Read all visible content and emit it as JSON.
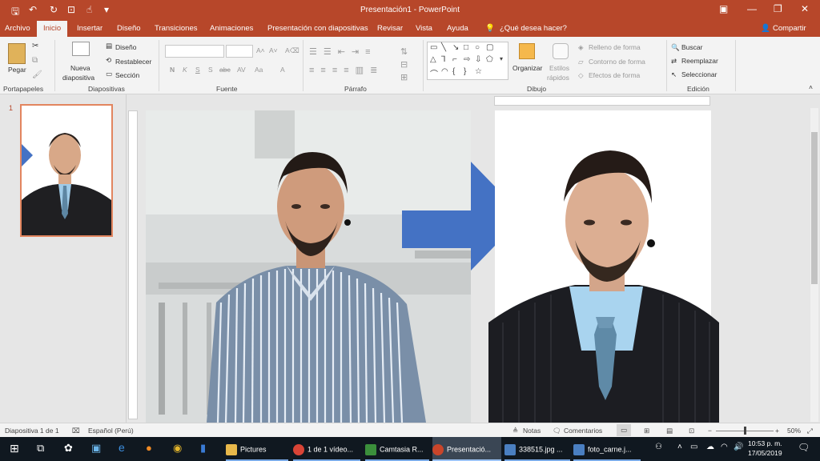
{
  "window": {
    "title": "Presentación1  -  PowerPoint",
    "share": "Compartir"
  },
  "quick_access": {
    "icons": [
      "save-icon",
      "undo-icon",
      "redo-icon",
      "present-icon",
      "touch-icon",
      "customize-icon"
    ]
  },
  "tabs": [
    "Archivo",
    "Inicio",
    "Insertar",
    "Diseño",
    "Transiciones",
    "Animaciones",
    "Presentación con diapositivas",
    "Revisar",
    "Vista",
    "Ayuda"
  ],
  "tell_me": "¿Qué desea hacer?",
  "ribbon": {
    "portapapeles": {
      "paste": "Pegar",
      "label": "Portapapeles"
    },
    "diapositivas": {
      "new_line1": "Nueva",
      "new_line2": "diapositiva",
      "layout": "Diseño",
      "reset": "Restablecer",
      "section": "Sección",
      "label": "Diapositivas"
    },
    "fuente": {
      "label": "Fuente",
      "buttons": [
        "N",
        "K",
        "S",
        "S",
        "abc",
        "AV",
        "Aa",
        "A"
      ]
    },
    "parrafo": {
      "label": "Párrafo"
    },
    "dibujo": {
      "organize": "Organizar",
      "styles_line1": "Estilos",
      "styles_line2": "rápidos",
      "fill": "Relleno de forma",
      "outline": "Contorno de forma",
      "effects": "Efectos de forma",
      "label": "Dibujo"
    },
    "edicion": {
      "find": "Buscar",
      "replace": "Reemplazar",
      "select": "Seleccionar",
      "label": "Edición"
    }
  },
  "slide_pane": {
    "slide_number": "1"
  },
  "status": {
    "slide": "Diapositiva 1 de 1",
    "language": "Español (Perú)",
    "notes": "Notas",
    "comments": "Comentarios",
    "zoom": "50%",
    "zoom_level": 0.5
  },
  "taskbar": {
    "items": [
      {
        "label": "Pictures",
        "color": "#e8b84a"
      },
      {
        "label": "1 de 1 vídeo...",
        "color": "#d94436"
      },
      {
        "label": "Camtasia R...",
        "color": "#3b8f3b"
      },
      {
        "label": "Presentació...",
        "color": "#c9452a"
      },
      {
        "label": "338515.jpg ...",
        "color": "#4a7fc1"
      },
      {
        "label": "foto_carne.j...",
        "color": "#4a7fc1"
      }
    ],
    "time": "10:53 p. m.",
    "date": "17/05/2019"
  },
  "colors": {
    "accent": "#b7472a",
    "arrow": "#4472c4",
    "thumb_border": "#e2855f"
  }
}
